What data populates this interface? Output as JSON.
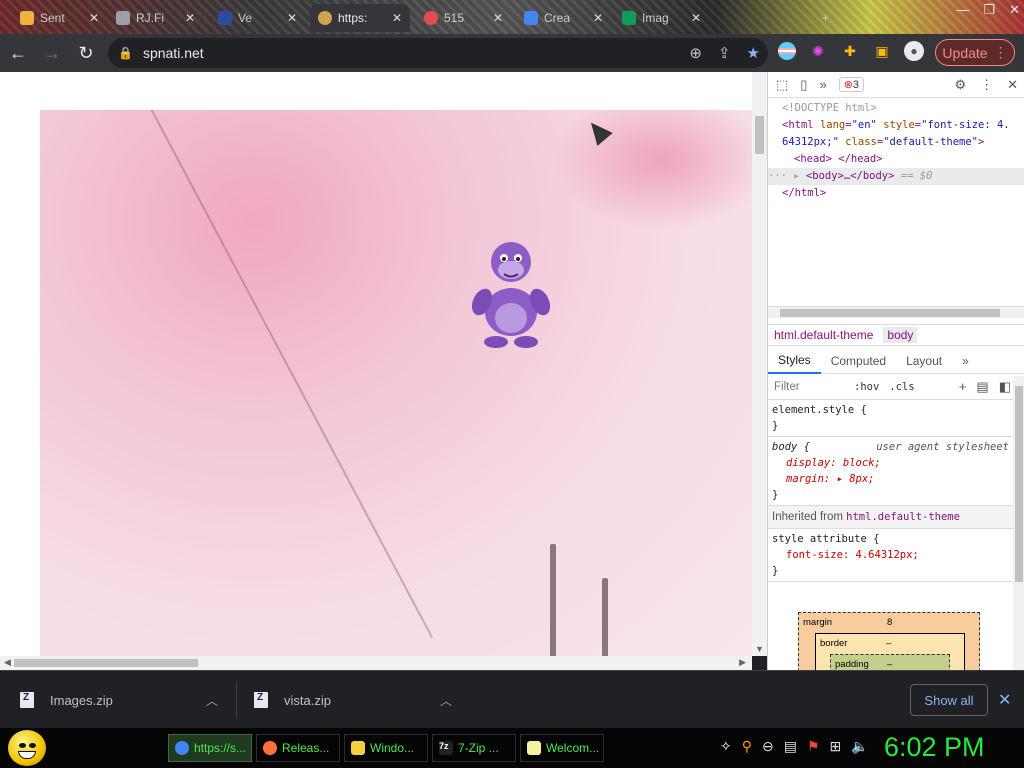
{
  "tabs": [
    {
      "label": "Sent",
      "color": "#f2b33d"
    },
    {
      "label": "RJ.Fi",
      "color": "#9aa0a6"
    },
    {
      "label": "Ve",
      "color": "#2a4d9f"
    },
    {
      "label": "https:",
      "color": "#d2a24c"
    },
    {
      "label": "515",
      "color": "#e34d4d"
    },
    {
      "label": "Crea",
      "color": "#4285f4"
    },
    {
      "label": "Imag",
      "color": "#0f9d58"
    }
  ],
  "window": {
    "minimize": "—",
    "maximize": "❐",
    "close": "✕"
  },
  "toolbar": {
    "back": "←",
    "forward": "→",
    "reload": "↻",
    "url": "spnati.net",
    "update_label": "Update"
  },
  "devtools": {
    "error_count": "3",
    "elements": {
      "doctype": "<!DOCTYPE html>",
      "html_open_1": "<html ",
      "lang_attr": "lang",
      "lang_val": "\"en\"",
      "style_attr": "style",
      "style_val_1": "\"font-size: 4.",
      "style_val_2": "64312px;\"",
      "class_attr": "class",
      "class_val": "\"default-theme\"",
      "head_line": "<head> </head>",
      "body_line": "<body>…</body>",
      "eq": "== $0",
      "html_close": "</html>"
    },
    "breadcrumbs": [
      "html.default-theme",
      "body"
    ],
    "subtabs": [
      "Styles",
      "Computed",
      "Layout",
      "»"
    ],
    "filter_placeholder": "Filter",
    "hov": ":hov",
    "cls": ".cls",
    "rules": {
      "element_style": "element.style {",
      "close": "}",
      "body_selector": "body {",
      "ua": "user agent stylesheet",
      "display": "display: block;",
      "margin": "margin: ▸ 8px;",
      "inherited_label": "Inherited from",
      "inherited_from": "html.default-theme",
      "style_attr": "style attribute {",
      "font_size": "font-size: 4.64312px;"
    },
    "boxmodel": {
      "margin": "margin",
      "margin_val": "8",
      "border": "border",
      "border_val": "–",
      "padding": "padding",
      "padding_val": "–"
    }
  },
  "downloads": {
    "items": [
      "Images.zip",
      "vista.zip"
    ],
    "show_all": "Show all"
  },
  "taskbar": {
    "tasks": [
      {
        "label": "https://s...",
        "color": "#4285f4"
      },
      {
        "label": "Releas...",
        "color": "#ff7139"
      },
      {
        "label": "Windo...",
        "color": "#f4d03f"
      },
      {
        "label": "7-Zip ...",
        "color": "#222222"
      },
      {
        "label": "Welcom...",
        "color": "#f4f4a0"
      }
    ],
    "clock": "6:02 PM"
  }
}
